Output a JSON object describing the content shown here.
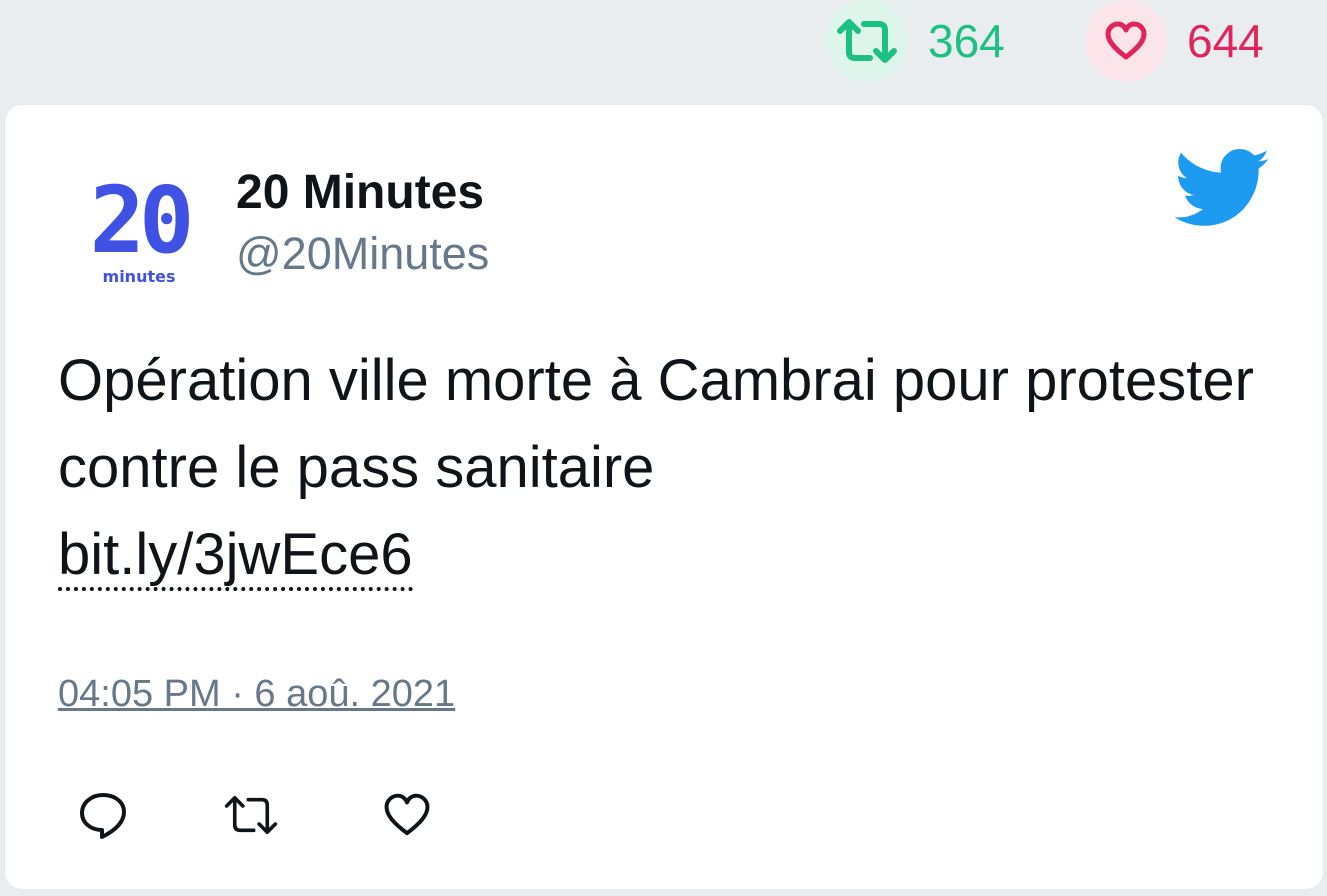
{
  "stats": {
    "retweet_count": "364",
    "like_count": "644",
    "retweet_icon": "retweet-icon",
    "like_icon": "heart-icon",
    "retweet_color": "#1cc083",
    "like_color": "#e0245e"
  },
  "tweet": {
    "author_name": "20 Minutes",
    "author_handle": "@20Minutes",
    "avatar_text": "20",
    "avatar_subtext": "minutes",
    "text": "Opération ville morte à Cambrai pour protester contre le pass sanitaire",
    "link": "bit.ly/3jwEce6",
    "timestamp": "04:05 PM · 6 aoû. 2021",
    "brand_icon": "twitter-bird-icon",
    "brand_color": "#1d9bf0"
  },
  "actions": {
    "reply_icon": "reply-icon",
    "retweet_icon": "retweet-icon",
    "like_icon": "heart-icon"
  }
}
